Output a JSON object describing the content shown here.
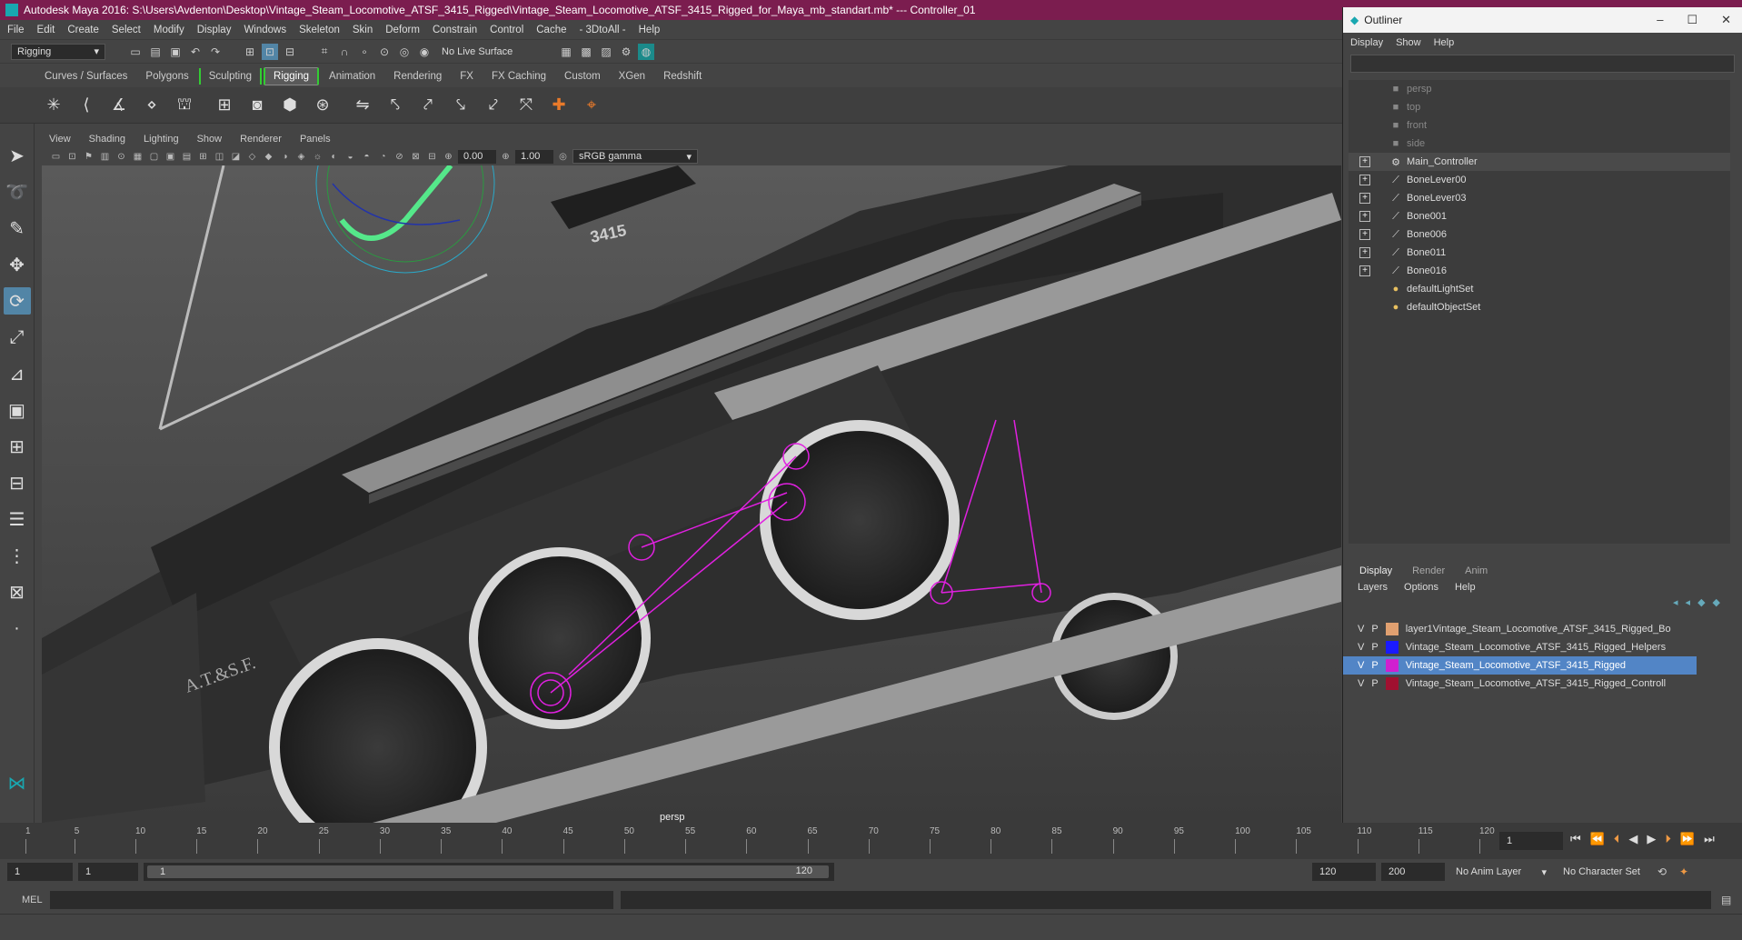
{
  "window": {
    "title": "Autodesk Maya 2016: S:\\Users\\Avdenton\\Desktop\\Vintage_Steam_Locomotive_ATSF_3415_Rigged\\Vintage_Steam_Locomotive_ATSF_3415_Rigged_for_Maya_mb_standart.mb*   ---   Controller_01"
  },
  "menubar": [
    "File",
    "Edit",
    "Create",
    "Select",
    "Modify",
    "Display",
    "Windows",
    "Skeleton",
    "Skin",
    "Deform",
    "Constrain",
    "Control",
    "Cache",
    "- 3DtoAll -",
    "Help"
  ],
  "status": {
    "menuset": "Rigging",
    "live_surface": "No Live Surface"
  },
  "shelf_tabs": [
    "Curves / Surfaces",
    "Polygons",
    "Sculpting",
    "Rigging",
    "Animation",
    "Rendering",
    "FX",
    "FX Caching",
    "Custom",
    "XGen",
    "Redshift"
  ],
  "shelf_active": "Rigging",
  "viewport": {
    "menu": [
      "View",
      "Shading",
      "Lighting",
      "Show",
      "Renderer",
      "Panels"
    ],
    "near": "0.00",
    "gain": "1.00",
    "colorspace": "sRGB gamma",
    "camera_label": "persp",
    "plate_number": "3415",
    "tender_text": "A.T.&S.F."
  },
  "outliner": {
    "title": "Outliner",
    "menu": [
      "Display",
      "Show",
      "Help"
    ],
    "items": [
      {
        "label": "persp",
        "type": "camera",
        "dim": true,
        "expand": false
      },
      {
        "label": "top",
        "type": "camera",
        "dim": true,
        "expand": false
      },
      {
        "label": "front",
        "type": "camera",
        "dim": true,
        "expand": false
      },
      {
        "label": "side",
        "type": "camera",
        "dim": true,
        "expand": false
      },
      {
        "label": "Main_Controller",
        "type": "controller",
        "dim": false,
        "expand": true,
        "selected": true
      },
      {
        "label": "BoneLever00",
        "type": "joint",
        "dim": false,
        "expand": true
      },
      {
        "label": "BoneLever03",
        "type": "joint",
        "dim": false,
        "expand": true
      },
      {
        "label": "Bone001",
        "type": "joint",
        "dim": false,
        "expand": true
      },
      {
        "label": "Bone006",
        "type": "joint",
        "dim": false,
        "expand": true
      },
      {
        "label": "Bone011",
        "type": "joint",
        "dim": false,
        "expand": true
      },
      {
        "label": "Bone016",
        "type": "joint",
        "dim": false,
        "expand": true
      },
      {
        "label": "defaultLightSet",
        "type": "set",
        "dim": false,
        "expand": false
      },
      {
        "label": "defaultObjectSet",
        "type": "set",
        "dim": false,
        "expand": false
      }
    ]
  },
  "layers": {
    "tabs": [
      "Display",
      "Render",
      "Anim"
    ],
    "menu": [
      "Layers",
      "Options",
      "Help"
    ],
    "rows": [
      {
        "v": "V",
        "p": "P",
        "color": "#e0a070",
        "name": "layer1Vintage_Steam_Locomotive_ATSF_3415_Rigged_Bo",
        "selected": false
      },
      {
        "v": "V",
        "p": "P",
        "color": "#1a1aff",
        "name": "Vintage_Steam_Locomotive_ATSF_3415_Rigged_Helpers",
        "selected": false
      },
      {
        "v": "V",
        "p": "P",
        "color": "#d020d0",
        "name": "Vintage_Steam_Locomotive_ATSF_3415_Rigged",
        "selected": true
      },
      {
        "v": "V",
        "p": "P",
        "color": "#a01030",
        "name": "Vintage_Steam_Locomotive_ATSF_3415_Rigged_Controll",
        "selected": false
      }
    ]
  },
  "timeline": {
    "ticks": [
      "1",
      "5",
      "10",
      "15",
      "20",
      "25",
      "30",
      "35",
      "40",
      "45",
      "50",
      "55",
      "60",
      "65",
      "70",
      "75",
      "80",
      "85",
      "90",
      "95",
      "100",
      "105",
      "110",
      "115",
      "120"
    ],
    "current_frame": "1"
  },
  "range": {
    "start": "1",
    "playback_start": "1",
    "slider_start": "1",
    "slider_end": "120",
    "playback_end": "120",
    "end": "200",
    "anim_layer": "No Anim Layer",
    "character_set": "No Character Set"
  },
  "cmd": {
    "label": "MEL"
  }
}
